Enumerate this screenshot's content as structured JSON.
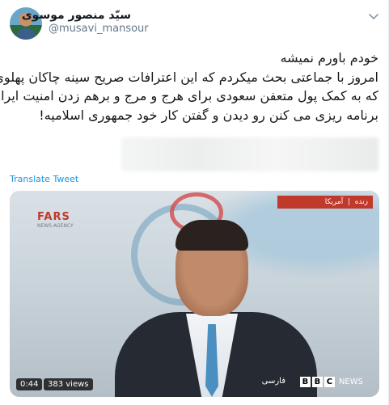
{
  "tweet": {
    "author_name": "سیّد منصور موسوی",
    "author_handle": "@musavi_mansour",
    "text_lines": [
      "خودم باورم نمیشه",
      "امروز با جماعتی بحث میکردم که این اعترافات صریح سینه چاکان پهلوی",
      "که به کمک پول متعفن سعودی برای هرج و مرج و برهم زدن امنیت ایران",
      "برنامه ریزی می کنن رو دیدن و گفتن کار خود جمهوری اسلامیه!"
    ],
    "translate_label": "Translate Tweet"
  },
  "video": {
    "watermark_left": "FARS",
    "watermark_left_sub": "NEWS AGENCY",
    "live_label": "زنده",
    "live_location": "آمریکا",
    "broadcaster_persian": "فارسی",
    "broadcaster_news": "NEWS",
    "bbc_letters": [
      "B",
      "B",
      "C"
    ],
    "duration": "0:44",
    "views": "383 views"
  },
  "icons": {
    "options": "chevron-down-icon"
  },
  "colors": {
    "link": "#1b95e0",
    "handle": "#657786",
    "live_bar": "#c0392b"
  }
}
